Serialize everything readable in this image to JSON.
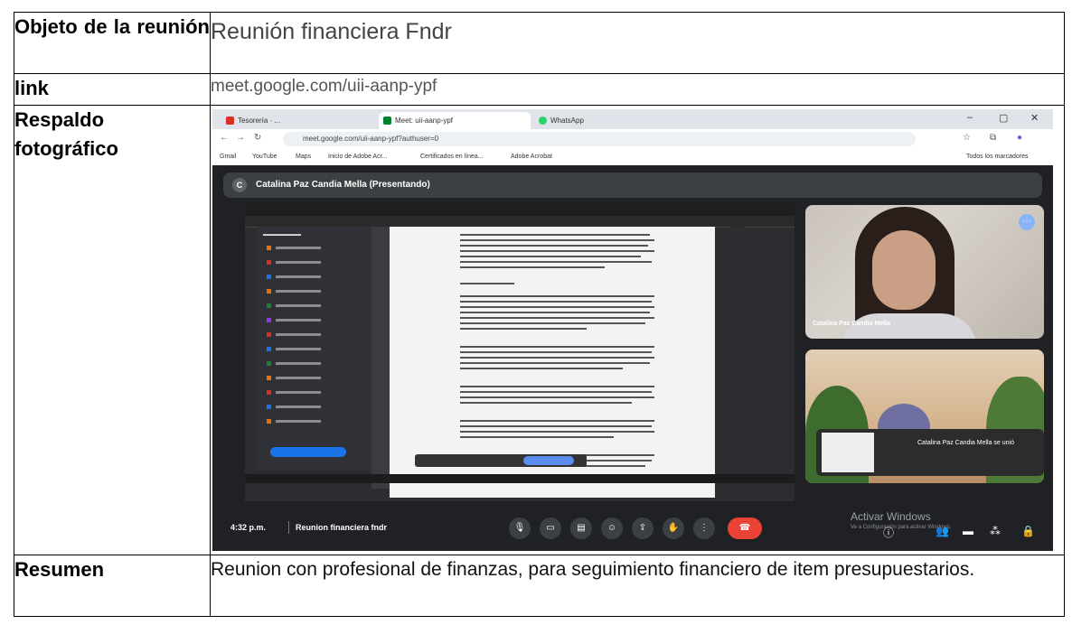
{
  "rows": {
    "objective": {
      "label": "Objeto de la reunión",
      "value": "Reunión financiera Fndr"
    },
    "link": {
      "label": "link",
      "value": "meet.google.com/uii-aanp-ypf"
    },
    "photo": {
      "label": "Respaldo fotográfico"
    },
    "summary": {
      "label": "Resumen",
      "value": "Reunion con profesional de finanzas, para seguimiento financiero de item presupuestarios."
    }
  },
  "screenshot": {
    "tabs": [
      "Tesorería · ...",
      "Meet: uii-aanp-ypf",
      "WhatsApp"
    ],
    "url": "meet.google.com/uii-aanp-ypf?authuser=0",
    "bookmarks": [
      "Gmail",
      "YouTube",
      "Maps",
      "Inicio de Adobe Acr...",
      "Certificados en línea...",
      "Adobe Acrobat"
    ],
    "bookmarks_right": "Todos los marcadores",
    "presenter_initial": "C",
    "presenter_banner": "Catalina Paz Candia Mella (Presentando)",
    "tile1_name": "Catalina Paz Candia Mella",
    "toast_text": "Catalina Paz Candia Mella se unió",
    "time": "4:32 p.m.",
    "meeting_name": "Reunion financiera fndr",
    "watermark": "Activar Windows",
    "watermark_sub": "Ve a Configuración para activar Windows."
  },
  "icons": {
    "mic": "mic-icon",
    "camera": "camera-icon",
    "captions": "captions-icon",
    "emoji": "emoji-icon",
    "present": "present-icon",
    "hand": "raise-hand-icon",
    "more": "more-icon",
    "end": "end-call-icon"
  }
}
